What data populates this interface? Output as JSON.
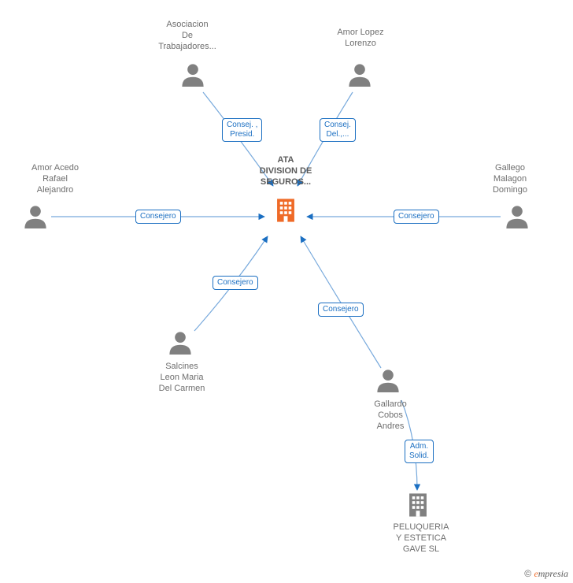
{
  "central": {
    "label": "ATA\nDIVISION DE\nSEGUROS..."
  },
  "people": {
    "asociacion": {
      "label": "Asociacion\nDe\nTrabajadores..."
    },
    "amor_lopez": {
      "label": "Amor Lopez\nLorenzo"
    },
    "amor_acedo": {
      "label": "Amor Acedo\nRafael\nAlejandro"
    },
    "gallego": {
      "label": "Gallego\nMalagon\nDomingo"
    },
    "salcines": {
      "label": "Salcines\nLeon Maria\nDel Carmen"
    },
    "gallardo": {
      "label": "Gallardo\nCobos\nAndres"
    }
  },
  "companies": {
    "peluqueria": {
      "label": "PELUQUERIA\nY ESTETICA\nGAVE SL"
    }
  },
  "edge_labels": {
    "asociacion": "Consej. ,\nPresid.",
    "amor_lopez": "Consej.\nDel.,...",
    "amor_acedo": "Consejero",
    "gallego": "Consejero",
    "salcines": "Consejero",
    "gallardo": "Consejero",
    "gallardo_peluqueria": "Adm.\nSolid."
  },
  "footer": {
    "copyright": "©",
    "brand_first": "e",
    "brand_rest": "mpresia"
  }
}
